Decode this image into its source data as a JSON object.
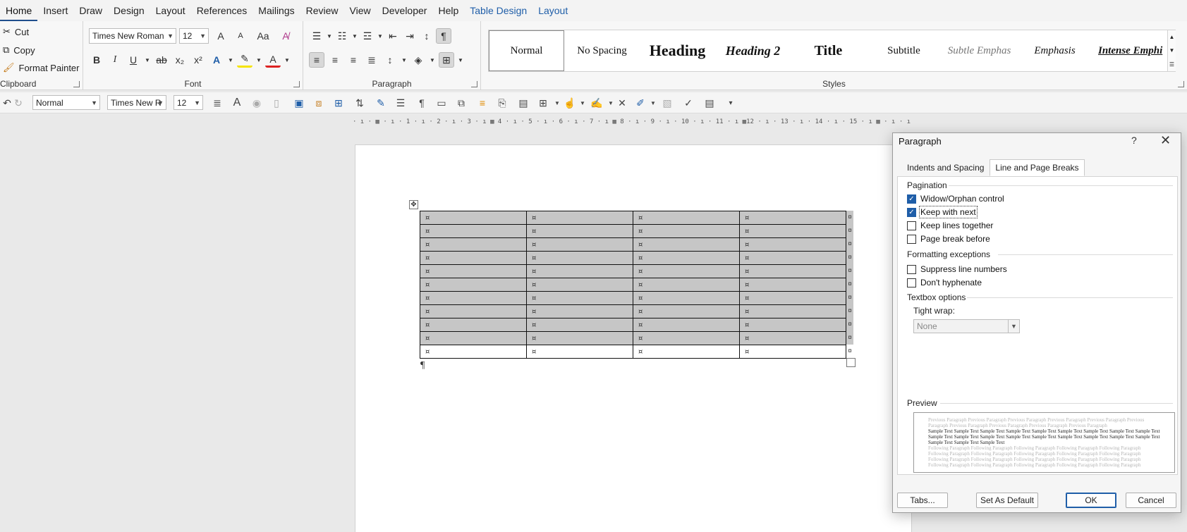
{
  "menubar": {
    "items": [
      "Home",
      "Insert",
      "Draw",
      "Design",
      "Layout",
      "References",
      "Mailings",
      "Review",
      "View",
      "Developer",
      "Help"
    ],
    "contextual": [
      "Table Design",
      "Layout"
    ]
  },
  "ribbon": {
    "clipboard": {
      "cut": "Cut",
      "copy": "Copy",
      "format_painter": "Format Painter",
      "label": "Clipboard"
    },
    "font": {
      "name": "Times New Roman",
      "size": "12",
      "label": "Font",
      "case_label": "Aa",
      "grow_label": "A",
      "shrink_label": "A"
    },
    "paragraph": {
      "label": "Paragraph"
    },
    "styles": {
      "label": "Styles",
      "items": [
        "Normal",
        "No Spacing",
        "Heading",
        "Heading 2",
        "Title",
        "Subtitle",
        "Subtle Emphas",
        "Emphasis",
        "Intense Emphi"
      ]
    }
  },
  "qat": {
    "style": "Normal",
    "font": "Times New R",
    "size": "12"
  },
  "ruler": {
    "text": "· ı · ▦ · ı · 1 · ı · 2 · ı · 3 · ı ▦ 4 · ı · 5 · ı · 6 · ı · 7 · ı ▦ 8 · ı · 9 · ı · 10 · ı · 11 · ı ▦12 · ı · 13 · ı · 14 · ı · 15 · ı ▦ · ı · ı · ı · ı"
  },
  "document": {
    "cell_marker": "¤",
    "paragraph_mark": "¶",
    "move_handle": "✥"
  },
  "dialog": {
    "title": "Paragraph",
    "help": "?",
    "close": "✕",
    "tabs": [
      "Indents and Spacing",
      "Line and Page Breaks"
    ],
    "pagination_label": "Pagination",
    "widow": "Widow/Orphan control",
    "keep_next": "Keep with next",
    "keep_lines": "Keep lines together",
    "page_break": "Page break before",
    "formatting_label": "Formatting exceptions",
    "suppress": "Suppress line numbers",
    "hyphenate": "Don't hyphenate",
    "textbox_label": "Textbox options",
    "tight_wrap_label": "Tight wrap:",
    "tight_wrap_value": "None",
    "preview_label": "Preview",
    "preview_prev": "Previous Paragraph Previous Paragraph Previous Paragraph Previous Paragraph Previous Paragraph Previous Paragraph Previous Paragraph Previous Paragraph Previous Paragraph Previous Paragraph",
    "preview_sample": "Sample Text Sample Text Sample Text Sample Text Sample Text Sample Text Sample Text Sample Text Sample Text Sample Text Sample Text Sample Text Sample Text Sample Text Sample Text Sample Text Sample Text Sample Text Sample Text Sample Text Sample Text",
    "preview_next": "Following Paragraph Following Paragraph Following Paragraph Following Paragraph Following Paragraph Following Paragraph Following Paragraph Following Paragraph Following Paragraph Following Paragraph Following Paragraph Following Paragraph Following Paragraph Following Paragraph Following Paragraph Following Paragraph Following Paragraph Following Paragraph Following Paragraph Following Paragraph",
    "tabs_btn": "Tabs...",
    "default_btn": "Set As Default",
    "ok_btn": "OK",
    "cancel_btn": "Cancel"
  }
}
